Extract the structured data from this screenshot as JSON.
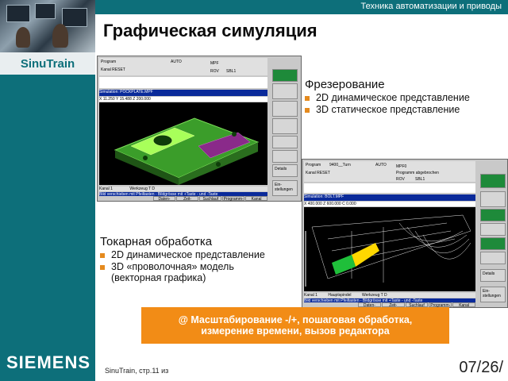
{
  "header": {
    "company_tagline": "Техника автоматизации и приводы",
    "title": "Графическая симуляция"
  },
  "brand": {
    "product": "SinuTrain",
    "logo": "SIEMENS"
  },
  "milling": {
    "heading": "Фрезерование",
    "items": [
      "2D динамическое представление",
      "3D статическое представление"
    ]
  },
  "turning": {
    "heading": "Токарная обработка",
    "items": [
      "2D динамическое представление",
      "3D «проволочная» модель",
      "(векторная графика)"
    ]
  },
  "callout": {
    "line1": "@ Масштабирование -/+, пошаговая обработка,",
    "line2": "измерение времени, вызов редактора"
  },
  "footer": {
    "page_label": "SinuTrain, стр.11  из",
    "date": "07/26/"
  },
  "screen_mill": {
    "program_label": "Program",
    "channel_reset": "Kanal RESET",
    "mode": "AUTO",
    "mpf": "MPF",
    "rov": "ROV",
    "sbl": "SBL1",
    "sim_bar": "Simulation: POCKPLATE.MPF",
    "coords": "X 11.250   Y 15.488   Z 200.000",
    "status1": "Kanal 1",
    "status2": "Werkzeug T  D",
    "hint": "Bild verschieben mit Pfeiltasten - Bildgrösse mit +Taste - und -Taste",
    "softkeys": [
      "Daten-abgleich",
      "Zeit-Auswertung",
      "Suchlauf",
      "Programm-korrektur",
      "Kanal Spindel"
    ],
    "side_labels": [
      "Details",
      "Ein-stellungen"
    ]
  },
  "screen_turn": {
    "program_label": "Program",
    "program_name": "9400__Turn",
    "mode": "AUTO",
    "channel_reset": "Kanal RESET",
    "mpf": "MPF0",
    "program_abort": "Programm abgebrochen",
    "rov": "ROV",
    "sbl": "SBL1",
    "sim_bar": "Simulation: BOLT.MPF",
    "coords": "X  400.000   Z  600.000   C  0.000",
    "status1": "Kanal 1",
    "status2": "Hauptspindel",
    "status3": "Werkzeug T  D",
    "hint": "Bild verschieben mit Pfeiltasten - Bildgrösse mit +Taste - und -Taste",
    "softkeys": [
      "Daten-abgleich",
      "Zeit-Auswertung",
      "Suchlauf",
      "Programm-korrektur",
      "Kanal Spindel"
    ],
    "side_labels": [
      "Details",
      "Ein-stellungen"
    ]
  },
  "colors": {
    "teal": "#0d6f7a",
    "orange": "#f28c16",
    "bullet": "#e58a1e",
    "screen_blue": "#0a2a9a"
  }
}
